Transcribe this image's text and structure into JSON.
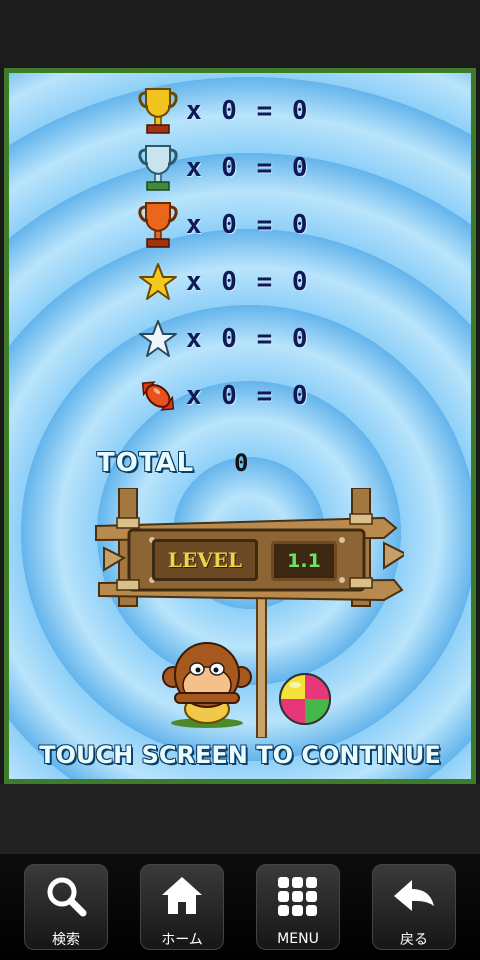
{
  "scores": [
    {
      "icon": "gold-trophy-icon",
      "text": "x 0 = 0"
    },
    {
      "icon": "silver-trophy-icon",
      "text": "x 0 = 0"
    },
    {
      "icon": "bronze-trophy-icon",
      "text": "x 0 = 0"
    },
    {
      "icon": "gold-star-icon",
      "text": "x 0 = 0"
    },
    {
      "icon": "silver-star-icon",
      "text": "x 0 = 0"
    },
    {
      "icon": "candy-icon",
      "text": "x 0 = 0"
    }
  ],
  "total": {
    "label": "TOTAL",
    "value": "0"
  },
  "level": {
    "label": "LEVEL",
    "number": "1.1"
  },
  "prompt": "TOUCH SCREEN TO CONTINUE",
  "nav": {
    "search": "検索",
    "home": "ホーム",
    "menu": "MENU",
    "back": "戻る"
  },
  "colors": {
    "frame": "#3e7c2a",
    "background": "#63b4ec",
    "score_text": "#0f1a55"
  }
}
